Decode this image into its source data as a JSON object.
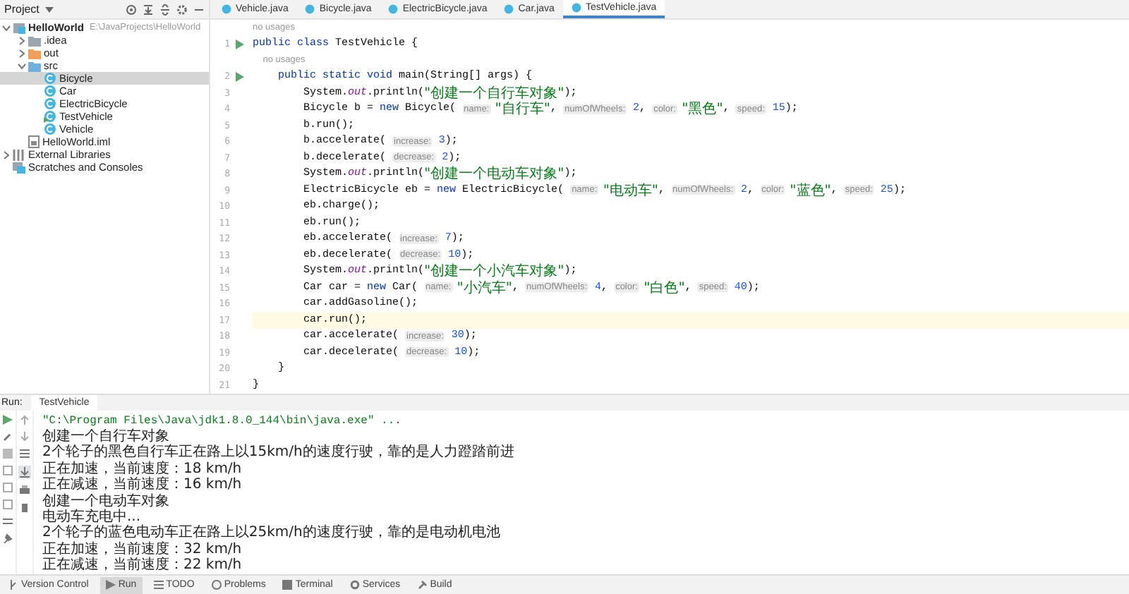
{
  "project": {
    "title": "Project",
    "tree": [
      {
        "label": "HelloWorld",
        "path": "E:\\JavaProjects\\HelloWorld",
        "kind": "module",
        "expanded": true,
        "selected": false,
        "children": [
          {
            "label": ".idea",
            "kind": "folder",
            "expanded": false,
            "selected": false
          },
          {
            "label": "out",
            "kind": "folder-excluded",
            "expanded": false,
            "selected": false
          },
          {
            "label": "src",
            "kind": "folder-source",
            "expanded": true,
            "selected": false,
            "children": [
              {
                "label": "Bicycle",
                "kind": "class",
                "selected": true
              },
              {
                "label": "Car",
                "kind": "class",
                "selected": false
              },
              {
                "label": "ElectricBicycle",
                "kind": "class",
                "selected": false
              },
              {
                "label": "TestVehicle",
                "kind": "class-main",
                "selected": false
              },
              {
                "label": "Vehicle",
                "kind": "class",
                "selected": false
              }
            ]
          },
          {
            "label": "HelloWorld.iml",
            "kind": "file",
            "selected": false
          }
        ]
      },
      {
        "label": "External Libraries",
        "kind": "library",
        "expanded": false,
        "selected": false
      },
      {
        "label": "Scratches and Consoles",
        "kind": "scratch",
        "selected": false
      }
    ]
  },
  "editor": {
    "tabs": [
      {
        "label": "Vehicle.java",
        "selected": false
      },
      {
        "label": "Bicycle.java",
        "selected": false
      },
      {
        "label": "ElectricBicycle.java",
        "selected": false
      },
      {
        "label": "Car.java",
        "selected": false
      },
      {
        "label": "TestVehicle.java",
        "selected": true
      }
    ],
    "lines": [
      {
        "kind": "usage",
        "text": "no usages"
      },
      {
        "kind": "code",
        "number": "1",
        "run": true,
        "current": false,
        "tokens": [
          {
            "kind": "kw",
            "text": "public class"
          },
          {
            "kind": "plain",
            "text": " TestVehicle {"
          }
        ]
      },
      {
        "kind": "usage",
        "text": "    no usages"
      },
      {
        "kind": "code",
        "number": "2",
        "run": true,
        "current": false,
        "tokens": [
          {
            "kind": "kw",
            "text": "    public static void"
          },
          {
            "kind": "plain",
            "text": " main(String[] args) {"
          }
        ]
      },
      {
        "kind": "code",
        "number": "3",
        "run": false,
        "current": false,
        "tokens": [
          {
            "kind": "plain",
            "text": "        System."
          },
          {
            "kind": "field",
            "text": "out"
          },
          {
            "kind": "plain",
            "text": ".println("
          },
          {
            "kind": "str",
            "text": "\"创建一个自行车对象\""
          },
          {
            "kind": "plain",
            "text": ");"
          }
        ]
      },
      {
        "kind": "code",
        "number": "4",
        "run": false,
        "current": false,
        "tokens": [
          {
            "kind": "plain",
            "text": "        Bicycle b = "
          },
          {
            "kind": "kw",
            "text": "new"
          },
          {
            "kind": "plain",
            "text": " Bicycle( "
          },
          {
            "kind": "hint",
            "text": "name:"
          },
          {
            "kind": "str",
            "text": " \"自行车\""
          },
          {
            "kind": "plain",
            "text": ", "
          },
          {
            "kind": "hint",
            "text": "numOfWheels:"
          },
          {
            "kind": "num",
            "text": " 2"
          },
          {
            "kind": "plain",
            "text": ", "
          },
          {
            "kind": "hint",
            "text": "color:"
          },
          {
            "kind": "str",
            "text": " \"黑色\""
          },
          {
            "kind": "plain",
            "text": ", "
          },
          {
            "kind": "hint",
            "text": "speed:"
          },
          {
            "kind": "num",
            "text": " 15"
          },
          {
            "kind": "plain",
            "text": ");"
          }
        ]
      },
      {
        "kind": "code",
        "number": "5",
        "run": false,
        "current": false,
        "tokens": [
          {
            "kind": "plain",
            "text": "        b.run();"
          }
        ]
      },
      {
        "kind": "code",
        "number": "6",
        "run": false,
        "current": false,
        "tokens": [
          {
            "kind": "plain",
            "text": "        b.accelerate( "
          },
          {
            "kind": "hint",
            "text": "increase:"
          },
          {
            "kind": "num",
            "text": " 3"
          },
          {
            "kind": "plain",
            "text": ");"
          }
        ]
      },
      {
        "kind": "code",
        "number": "7",
        "run": false,
        "current": false,
        "tokens": [
          {
            "kind": "plain",
            "text": "        b.decelerate( "
          },
          {
            "kind": "hint",
            "text": "decrease:"
          },
          {
            "kind": "num",
            "text": " 2"
          },
          {
            "kind": "plain",
            "text": ");"
          }
        ]
      },
      {
        "kind": "code",
        "number": "8",
        "run": false,
        "current": false,
        "tokens": [
          {
            "kind": "plain",
            "text": "        System."
          },
          {
            "kind": "field",
            "text": "out"
          },
          {
            "kind": "plain",
            "text": ".println("
          },
          {
            "kind": "str",
            "text": "\"创建一个电动车对象\""
          },
          {
            "kind": "plain",
            "text": ");"
          }
        ]
      },
      {
        "kind": "code",
        "number": "9",
        "run": false,
        "current": false,
        "tokens": [
          {
            "kind": "plain",
            "text": "        ElectricBicycle eb = "
          },
          {
            "kind": "kw",
            "text": "new"
          },
          {
            "kind": "plain",
            "text": " ElectricBicycle( "
          },
          {
            "kind": "hint",
            "text": "name:"
          },
          {
            "kind": "str",
            "text": " \"电动车\""
          },
          {
            "kind": "plain",
            "text": ", "
          },
          {
            "kind": "hint",
            "text": "numOfWheels:"
          },
          {
            "kind": "num",
            "text": " 2"
          },
          {
            "kind": "plain",
            "text": ", "
          },
          {
            "kind": "hint",
            "text": "color:"
          },
          {
            "kind": "str",
            "text": " \"蓝色\""
          },
          {
            "kind": "plain",
            "text": ", "
          },
          {
            "kind": "hint",
            "text": "speed:"
          },
          {
            "kind": "num",
            "text": " 25"
          },
          {
            "kind": "plain",
            "text": ");"
          }
        ]
      },
      {
        "kind": "code",
        "number": "10",
        "run": false,
        "current": false,
        "tokens": [
          {
            "kind": "plain",
            "text": "        eb.charge();"
          }
        ]
      },
      {
        "kind": "code",
        "number": "11",
        "run": false,
        "current": false,
        "tokens": [
          {
            "kind": "plain",
            "text": "        eb.run();"
          }
        ]
      },
      {
        "kind": "code",
        "number": "12",
        "run": false,
        "current": false,
        "tokens": [
          {
            "kind": "plain",
            "text": "        eb.accelerate( "
          },
          {
            "kind": "hint",
            "text": "increase:"
          },
          {
            "kind": "num",
            "text": " 7"
          },
          {
            "kind": "plain",
            "text": ");"
          }
        ]
      },
      {
        "kind": "code",
        "number": "13",
        "run": false,
        "current": false,
        "tokens": [
          {
            "kind": "plain",
            "text": "        eb.decelerate( "
          },
          {
            "kind": "hint",
            "text": "decrease:"
          },
          {
            "kind": "num",
            "text": " 10"
          },
          {
            "kind": "plain",
            "text": ");"
          }
        ]
      },
      {
        "kind": "code",
        "number": "14",
        "run": false,
        "current": false,
        "tokens": [
          {
            "kind": "plain",
            "text": "        System."
          },
          {
            "kind": "field",
            "text": "out"
          },
          {
            "kind": "plain",
            "text": ".println("
          },
          {
            "kind": "str",
            "text": "\"创建一个小汽车对象\""
          },
          {
            "kind": "plain",
            "text": ");"
          }
        ]
      },
      {
        "kind": "code",
        "number": "15",
        "run": false,
        "current": false,
        "tokens": [
          {
            "kind": "plain",
            "text": "        Car car = "
          },
          {
            "kind": "kw",
            "text": "new"
          },
          {
            "kind": "plain",
            "text": " Car( "
          },
          {
            "kind": "hint",
            "text": "name:"
          },
          {
            "kind": "str",
            "text": " \"小汽车\""
          },
          {
            "kind": "plain",
            "text": ", "
          },
          {
            "kind": "hint",
            "text": "numOfWheels:"
          },
          {
            "kind": "num",
            "text": " 4"
          },
          {
            "kind": "plain",
            "text": ", "
          },
          {
            "kind": "hint",
            "text": "color:"
          },
          {
            "kind": "str",
            "text": " \"白色\""
          },
          {
            "kind": "plain",
            "text": ", "
          },
          {
            "kind": "hint",
            "text": "speed:"
          },
          {
            "kind": "num",
            "text": " 40"
          },
          {
            "kind": "plain",
            "text": ");"
          }
        ]
      },
      {
        "kind": "code",
        "number": "16",
        "run": false,
        "current": false,
        "tokens": [
          {
            "kind": "plain",
            "text": "        car.addGasoline();"
          }
        ]
      },
      {
        "kind": "code",
        "number": "17",
        "run": false,
        "current": true,
        "tokens": [
          {
            "kind": "plain",
            "text": "        car.run();"
          }
        ]
      },
      {
        "kind": "code",
        "number": "18",
        "run": false,
        "current": false,
        "tokens": [
          {
            "kind": "plain",
            "text": "        car.accelerate( "
          },
          {
            "kind": "hint",
            "text": "increase:"
          },
          {
            "kind": "num",
            "text": " 30"
          },
          {
            "kind": "plain",
            "text": ");"
          }
        ]
      },
      {
        "kind": "code",
        "number": "19",
        "run": false,
        "current": false,
        "tokens": [
          {
            "kind": "plain",
            "text": "        car.decelerate( "
          },
          {
            "kind": "hint",
            "text": "decrease:"
          },
          {
            "kind": "num",
            "text": " 10"
          },
          {
            "kind": "plain",
            "text": ");"
          }
        ]
      },
      {
        "kind": "code",
        "number": "20",
        "run": false,
        "current": false,
        "tokens": [
          {
            "kind": "plain",
            "text": "    }"
          }
        ]
      },
      {
        "kind": "code",
        "number": "21",
        "run": false,
        "current": false,
        "tokens": [
          {
            "kind": "plain",
            "text": "}"
          }
        ]
      }
    ]
  },
  "run": {
    "label": "Run:",
    "tab": "TestVehicle",
    "output": [
      {
        "kind": "command",
        "text": "\"C:\\Program Files\\Java\\jdk1.8.0_144\\bin\\java.exe\" ..."
      },
      {
        "kind": "plain",
        "text": "创建一个自行车对象"
      },
      {
        "kind": "plain",
        "text": "2个轮子的黑色自行车正在路上以15km/h的速度行驶，靠的是人力蹬踏前进"
      },
      {
        "kind": "plain",
        "text": "正在加速，当前速度：18 km/h"
      },
      {
        "kind": "plain",
        "text": "正在减速，当前速度：16 km/h"
      },
      {
        "kind": "plain",
        "text": "创建一个电动车对象"
      },
      {
        "kind": "plain",
        "text": "电动车充电中..."
      },
      {
        "kind": "plain",
        "text": "2个轮子的蓝色电动车正在路上以25km/h的速度行驶，靠的是电动机电池"
      },
      {
        "kind": "plain",
        "text": "正在加速，当前速度：32 km/h"
      },
      {
        "kind": "plain",
        "text": "正在减速，当前速度：22 km/h"
      }
    ]
  },
  "bottom_bar": [
    {
      "label": "Version Control",
      "kind": "vcs",
      "selected": false
    },
    {
      "label": "Run",
      "kind": "run",
      "selected": true
    },
    {
      "label": "TODO",
      "kind": "todo",
      "selected": false
    },
    {
      "label": "Problems",
      "kind": "problems",
      "selected": false
    },
    {
      "label": "Terminal",
      "kind": "terminal",
      "selected": false
    },
    {
      "label": "Services",
      "kind": "services",
      "selected": false
    },
    {
      "label": "Build",
      "kind": "build",
      "selected": false
    }
  ]
}
